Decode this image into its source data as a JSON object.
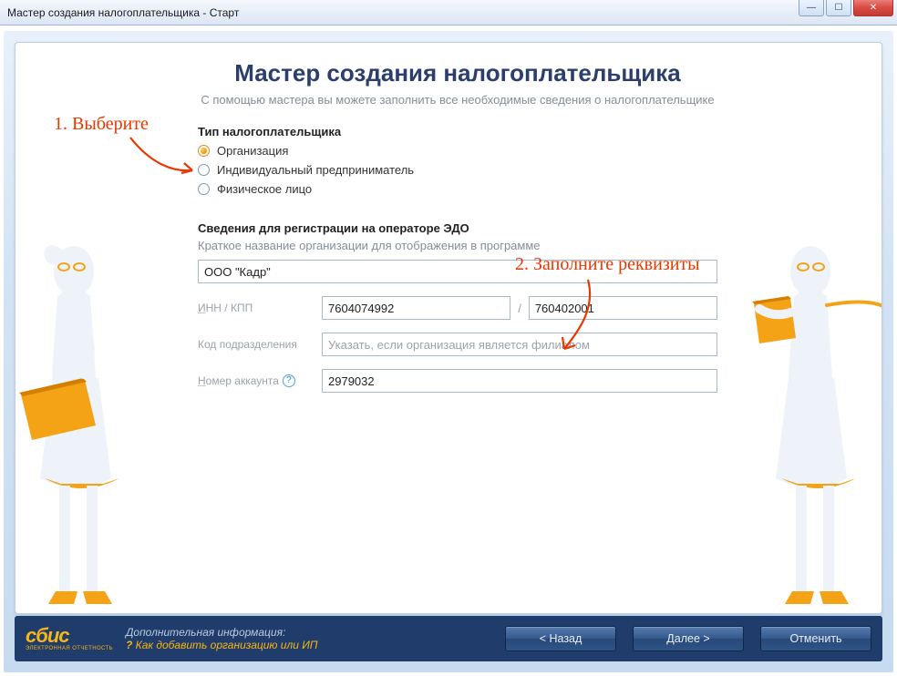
{
  "window": {
    "title": "Мастер создания налогоплательщика - Старт"
  },
  "annotations": {
    "step1": "1. Выберите",
    "step2": "2. Заполните реквизиты"
  },
  "header": {
    "title": "Мастер создания налогоплательщика",
    "subtitle": "С помощью мастера вы можете заполнить все необходимые сведения о налогоплательщике"
  },
  "type_group": {
    "label": "Тип налогоплательщика",
    "options": [
      {
        "label": "Организация",
        "checked": true
      },
      {
        "label": "Индивидуальный предприниматель",
        "checked": false
      },
      {
        "label": "Физическое лицо",
        "checked": false
      }
    ]
  },
  "reg_group": {
    "label": "Сведения для регистрации на операторе ЭДО",
    "hint": "Краткое название организации для отображения в программе",
    "org_name": "ООО \"Кадр\"",
    "inn_label_pre": "И",
    "inn_label_post": "НН / КПП",
    "inn": "7604074992",
    "kpp": "760402001",
    "dept_label": "Код подразделения",
    "dept_placeholder": "Указать, если организация является филиалом",
    "account_label_pre": "Н",
    "account_label_post": "омер аккаунта",
    "account": "2979032"
  },
  "footer": {
    "logo_top": "сбис",
    "logo_bot": "ЭЛЕКТРОННАЯ ОТЧЕТНОСТЬ",
    "extra_title": "Дополнительная информация:",
    "extra_link": "Как добавить организацию или ИП",
    "back": "< Назад",
    "next": "Далее >",
    "cancel": "Отменить"
  }
}
